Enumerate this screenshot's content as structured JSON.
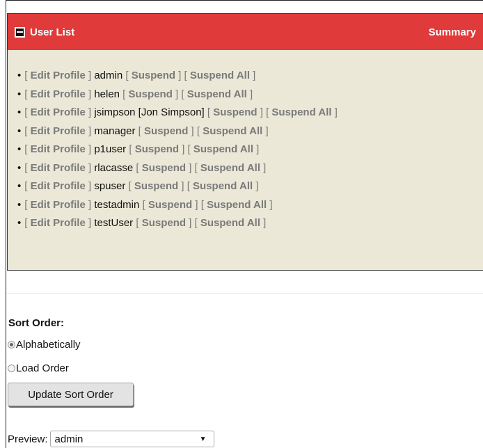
{
  "panel": {
    "title": "User List",
    "summary_label": "Summary",
    "edit_label": "Edit Profile",
    "suspend_label": "Suspend",
    "suspend_all_label": "Suspend All",
    "users": [
      "admin",
      "helen",
      "jsimpson [Jon Simpson]",
      "manager",
      "p1user",
      "rlacasse",
      "spuser",
      "testadmin",
      "testUser"
    ]
  },
  "sort": {
    "title": "Sort Order:",
    "options": [
      "Alphabetically",
      "Load Order"
    ],
    "selected": "Alphabetically",
    "button_label": "Update Sort Order"
  },
  "preview": {
    "label": "Preview:",
    "selected": "admin"
  },
  "colors": {
    "header_bg": "#e03a3a",
    "panel_bg": "#ebe8d7",
    "link": "#7a7a7a"
  }
}
